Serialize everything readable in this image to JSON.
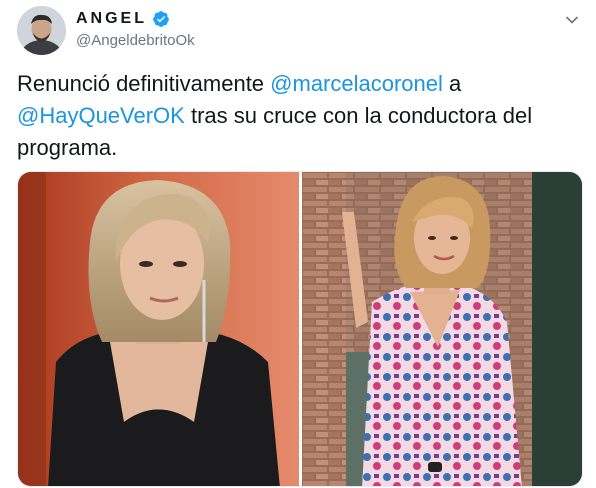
{
  "tweet": {
    "author": {
      "display_name": "ANGEL",
      "handle": "@AngeldebritoOk",
      "verified": true
    },
    "text": {
      "part1": "Renunció definitivamente ",
      "mention1": "@marcelacoronel",
      "part2": " a ",
      "mention2": "@HayQueVerOK",
      "part3": " tras su cruce con la conductora del programa."
    },
    "media_count": 2
  },
  "colors": {
    "link": "#1b95e0",
    "verified_badge": "#1da1f2",
    "secondary_text": "#657786"
  },
  "icons": {
    "verified": "verified-badge-icon",
    "caret": "chevron-down-icon"
  }
}
